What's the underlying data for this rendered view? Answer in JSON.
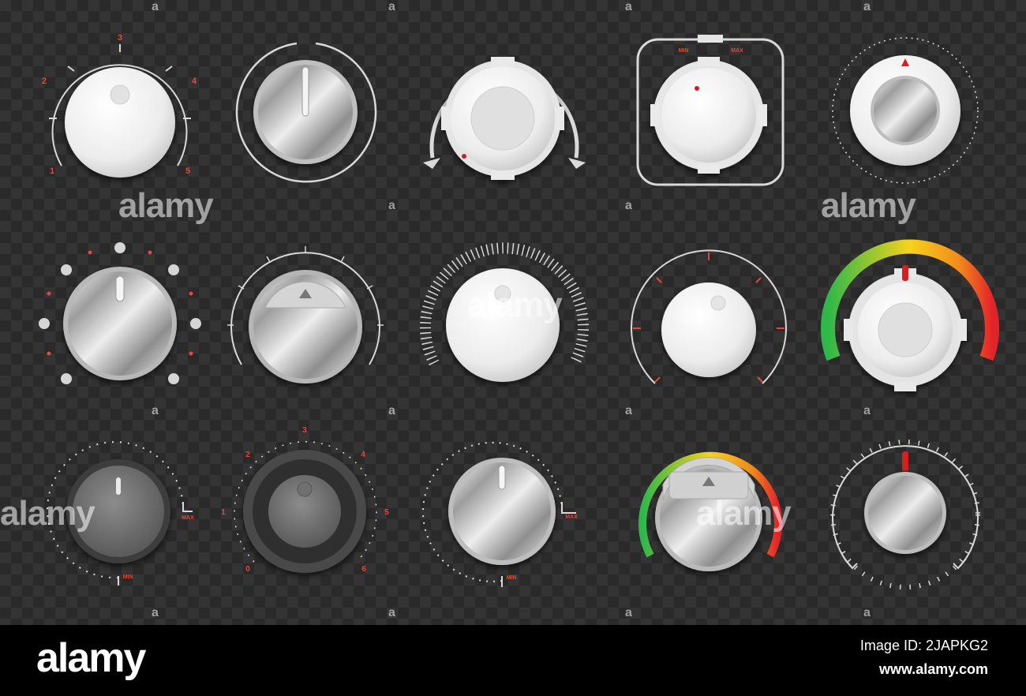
{
  "colors": {
    "red": "#e8453c",
    "chrome_light": "#f4f4f4",
    "chrome_dark": "#8a8a8a",
    "gauge_start": "#2fb84a",
    "gauge_mid": "#f6d21c",
    "gauge_end": "#e3232a"
  },
  "knobs": [
    {
      "id": "knob-1",
      "labels": [
        "1",
        "2",
        "3",
        "4",
        "5"
      ]
    },
    {
      "id": "knob-4",
      "labels": [
        "MIN",
        "MAX"
      ]
    },
    {
      "id": "knob-11",
      "labels": [
        "MAX",
        "MIN"
      ]
    },
    {
      "id": "knob-12",
      "labels": [
        "0",
        "1",
        "2",
        "3",
        "4",
        "5",
        "6"
      ]
    },
    {
      "id": "knob-13",
      "labels": [
        "MAX",
        "MIN"
      ]
    }
  ],
  "watermark": {
    "big": "alamy",
    "small": "a"
  },
  "footer": {
    "logo": "alamy",
    "image_id": "Image ID: 2JAPKG2",
    "url": "www.alamy.com"
  }
}
